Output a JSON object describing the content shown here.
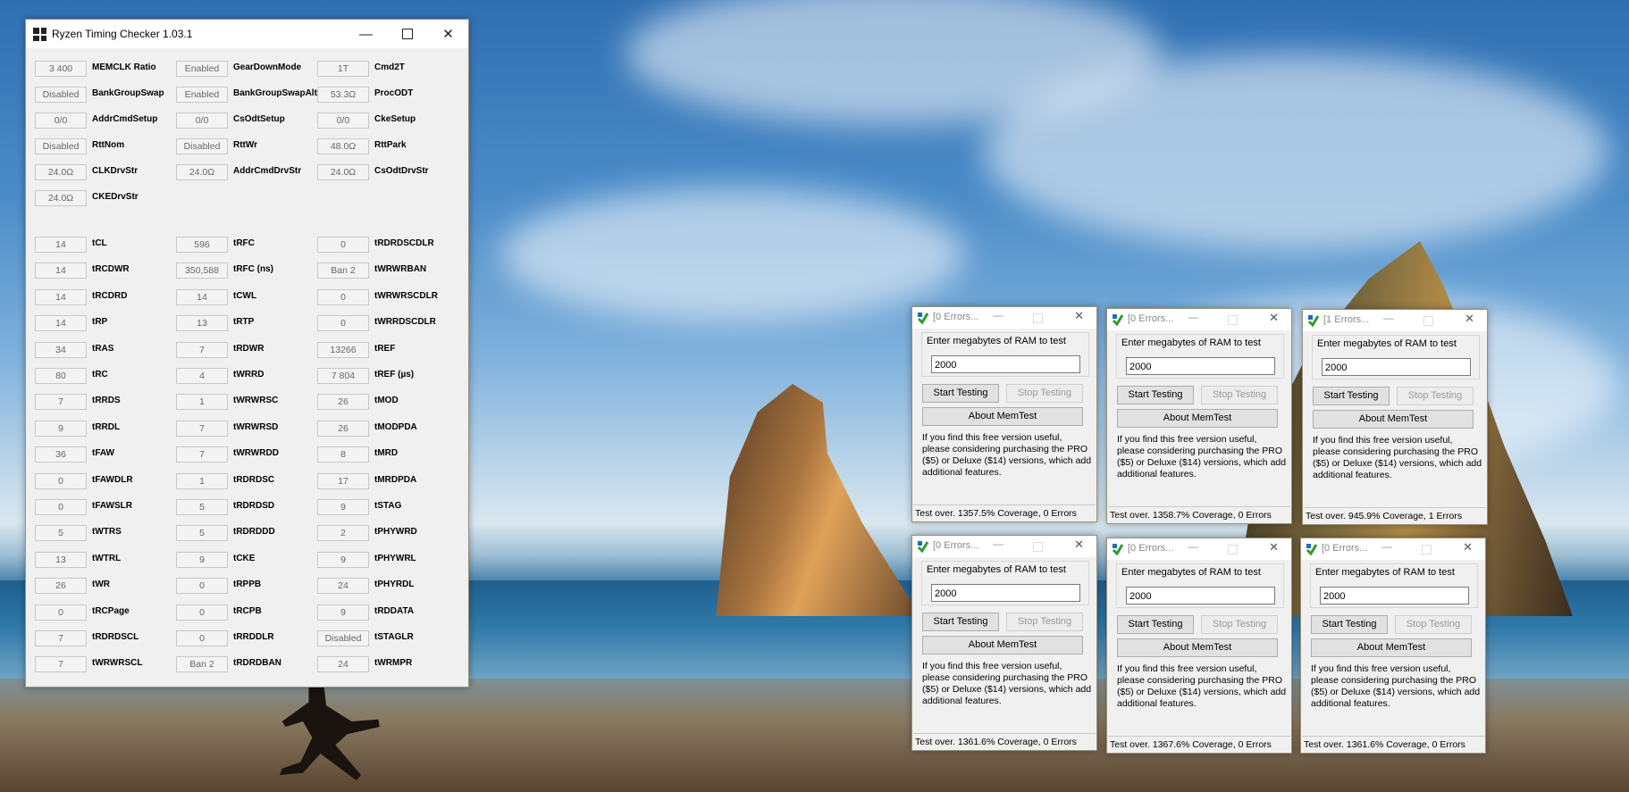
{
  "rtc": {
    "title": "Ryzen Timing Checker 1.03.1",
    "minimize": "—",
    "close": "✕",
    "top": [
      [
        {
          "v": "3 400",
          "l": "MEMCLK Ratio"
        },
        {
          "v": "Enabled",
          "l": "GearDownMode"
        },
        {
          "v": "1T",
          "l": "Cmd2T"
        }
      ],
      [
        {
          "v": "Disabled",
          "l": "BankGroupSwap"
        },
        {
          "v": "Enabled",
          "l": "BankGroupSwapAlt"
        },
        {
          "v": "53.3Ω",
          "l": "ProcODT"
        }
      ],
      [
        {
          "v": "0/0",
          "l": "AddrCmdSetup"
        },
        {
          "v": "0/0",
          "l": "CsOdtSetup"
        },
        {
          "v": "0/0",
          "l": "CkeSetup"
        }
      ],
      [
        {
          "v": "Disabled",
          "l": "RttNom"
        },
        {
          "v": "Disabled",
          "l": "RttWr"
        },
        {
          "v": "48.0Ω",
          "l": "RttPark"
        }
      ],
      [
        {
          "v": "24.0Ω",
          "l": "CLKDrvStr"
        },
        {
          "v": "24.0Ω",
          "l": "AddrCmdDrvStr"
        },
        {
          "v": "24.0Ω",
          "l": "CsOdtDrvStr"
        }
      ],
      [
        {
          "v": "24.0Ω",
          "l": "CKEDrvStr"
        }
      ]
    ],
    "timings": [
      [
        {
          "v": "14",
          "l": "tCL"
        },
        {
          "v": "596",
          "l": "tRFC"
        },
        {
          "v": "0",
          "l": "tRDRDSCDLR"
        }
      ],
      [
        {
          "v": "14",
          "l": "tRCDWR"
        },
        {
          "v": "350,588",
          "l": "tRFC (ns)"
        },
        {
          "v": "Ban 2",
          "l": "tWRWRBAN"
        }
      ],
      [
        {
          "v": "14",
          "l": "tRCDRD"
        },
        {
          "v": "14",
          "l": "tCWL"
        },
        {
          "v": "0",
          "l": "tWRWRSCDLR"
        }
      ],
      [
        {
          "v": "14",
          "l": "tRP"
        },
        {
          "v": "13",
          "l": "tRTP"
        },
        {
          "v": "0",
          "l": "tWRRDSCDLR"
        }
      ],
      [
        {
          "v": "34",
          "l": "tRAS"
        },
        {
          "v": "7",
          "l": "tRDWR"
        },
        {
          "v": "13266",
          "l": "tREF"
        }
      ],
      [
        {
          "v": "80",
          "l": "tRC"
        },
        {
          "v": "4",
          "l": "tWRRD"
        },
        {
          "v": "7 804",
          "l": "tREF (µs)"
        }
      ],
      [
        {
          "v": "7",
          "l": "tRRDS"
        },
        {
          "v": "1",
          "l": "tWRWRSC"
        },
        {
          "v": "26",
          "l": "tMOD"
        }
      ],
      [
        {
          "v": "9",
          "l": "tRRDL"
        },
        {
          "v": "7",
          "l": "tWRWRSD"
        },
        {
          "v": "26",
          "l": "tMODPDA"
        }
      ],
      [
        {
          "v": "36",
          "l": "tFAW"
        },
        {
          "v": "7",
          "l": "tWRWRDD"
        },
        {
          "v": "8",
          "l": "tMRD"
        }
      ],
      [
        {
          "v": "0",
          "l": "tFAWDLR"
        },
        {
          "v": "1",
          "l": "tRDRDSC"
        },
        {
          "v": "17",
          "l": "tMRDPDA"
        }
      ],
      [
        {
          "v": "0",
          "l": "tFAWSLR"
        },
        {
          "v": "5",
          "l": "tRDRDSD"
        },
        {
          "v": "9",
          "l": "tSTAG"
        }
      ],
      [
        {
          "v": "5",
          "l": "tWTRS"
        },
        {
          "v": "5",
          "l": "tRDRDDD"
        },
        {
          "v": "2",
          "l": "tPHYWRD"
        }
      ],
      [
        {
          "v": "13",
          "l": "tWTRL"
        },
        {
          "v": "9",
          "l": "tCKE"
        },
        {
          "v": "9",
          "l": "tPHYWRL"
        }
      ],
      [
        {
          "v": "26",
          "l": "tWR"
        },
        {
          "v": "0",
          "l": "tRPPB"
        },
        {
          "v": "24",
          "l": "tPHYRDL"
        }
      ],
      [
        {
          "v": "0",
          "l": "tRCPage"
        },
        {
          "v": "0",
          "l": "tRCPB"
        },
        {
          "v": "9",
          "l": "tRDDATA"
        }
      ],
      [
        {
          "v": "7",
          "l": "tRDRDSCL"
        },
        {
          "v": "0",
          "l": "tRRDDLR"
        },
        {
          "v": "Disabled",
          "l": "tSTAGLR"
        }
      ],
      [
        {
          "v": "7",
          "l": "tWRWRSCL"
        },
        {
          "v": "Ban 2",
          "l": "tRDRDBAN"
        },
        {
          "v": "24",
          "l": "tWRMPR"
        }
      ]
    ]
  },
  "memtest": {
    "prompt": "Enter megabytes of RAM to test",
    "start_label": "Start Testing",
    "stop_label": "Stop Testing",
    "about_label": "About MemTest",
    "note": "If you find this free version useful, please considering purchasing the PRO ($5) or Deluxe ($14) versions, which add additional features.",
    "minimize": "—",
    "close": "✕",
    "windows": [
      {
        "title": "[0 Errors...",
        "value": "2000",
        "status": "Test over. 1357.5% Coverage, 0 Errors"
      },
      {
        "title": "[0 Errors...",
        "value": "2000",
        "status": "Test over. 1358.7% Coverage, 0 Errors"
      },
      {
        "title": "[1 Errors...",
        "value": "2000",
        "status": "Test over. 945.9% Coverage, 1 Errors"
      },
      {
        "title": "[0 Errors...",
        "value": "2000",
        "status": "Test over. 1361.6% Coverage, 0 Errors"
      },
      {
        "title": "[0 Errors...",
        "value": "2000",
        "status": "Test over. 1367.6% Coverage, 0 Errors"
      },
      {
        "title": "[0 Errors...",
        "value": "2000",
        "status": "Test over. 1361.6% Coverage, 0 Errors"
      }
    ]
  }
}
